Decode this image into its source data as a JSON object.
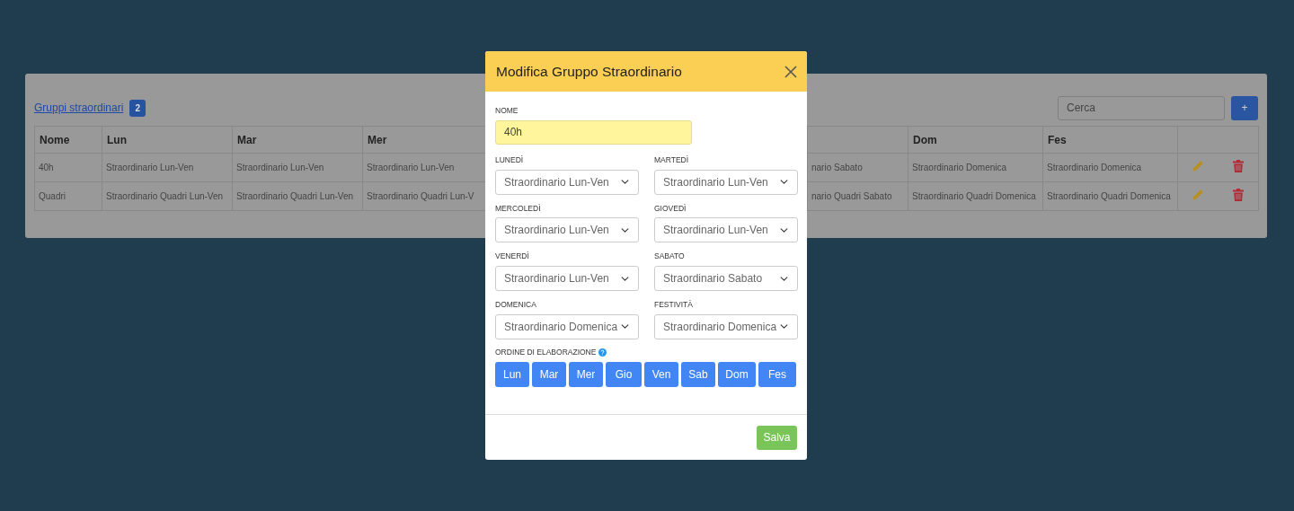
{
  "page": {
    "title_link": "Gruppi straordinari",
    "count_badge": "2",
    "search": {
      "placeholder": "Cerca"
    },
    "add_button": "+",
    "table": {
      "columns_left": [
        "Nome",
        "Lun",
        "Mar",
        "Mer"
      ],
      "columns_right": [
        "Dom",
        "Fes"
      ],
      "rows": [
        {
          "cells_left": [
            "40h",
            "Straordinario Lun-Ven",
            "Straordinario Lun-Ven",
            "Straordinario Lun-Ven"
          ],
          "cut_cell": "nario Sabato",
          "cells_right": [
            "Straordinario Domenica",
            "Straordinario Domenica"
          ]
        },
        {
          "cells_left": [
            "Quadri",
            "Straordinario Quadri Lun-Ven",
            "Straordinario Quadri Lun-Ven",
            "Straordinario Quadri Lun-V"
          ],
          "cut_cell": "nario Quadri Sabato",
          "cells_right": [
            "Straordinario Quadri Domenica",
            "Straordinario Quadri Domenica"
          ]
        }
      ]
    }
  },
  "modal": {
    "title": "Modifica Gruppo Straordinario",
    "name_label": "NOME",
    "name_value": "40h",
    "selects": [
      {
        "label": "LUNEDÌ",
        "value": "Straordinario Lun-Ven"
      },
      {
        "label": "MARTEDÌ",
        "value": "Straordinario Lun-Ven"
      },
      {
        "label": "MERCOLEDÌ",
        "value": "Straordinario Lun-Ven"
      },
      {
        "label": "GIOVEDÌ",
        "value": "Straordinario Lun-Ven"
      },
      {
        "label": "VENERDÌ",
        "value": "Straordinario Lun-Ven"
      },
      {
        "label": "SABATO",
        "value": "Straordinario Sabato"
      },
      {
        "label": "DOMENICA",
        "value": "Straordinario Domenica"
      },
      {
        "label": "FESTIVITÀ",
        "value": "Straordinario Domenica"
      }
    ],
    "order_label": "ORDINE DI ELABORAZIONE",
    "order_buttons": [
      "Lun",
      "Mar",
      "Mer",
      "Gio",
      "Ven",
      "Sab",
      "Dom",
      "Fes"
    ],
    "save_button": "Salva"
  }
}
